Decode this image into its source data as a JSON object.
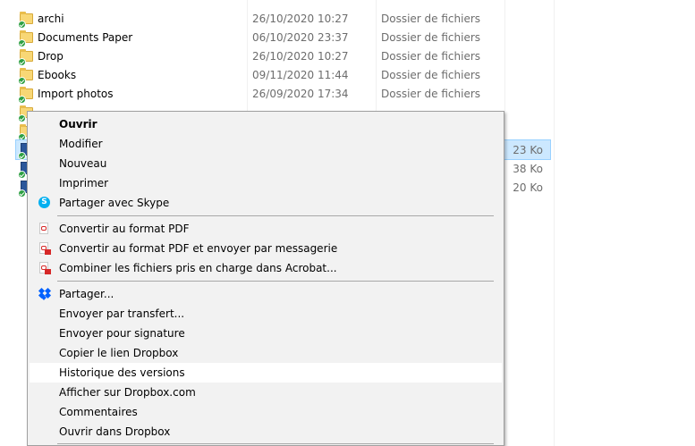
{
  "file_list": {
    "rows": [
      {
        "name": "archi",
        "date": "26/10/2020 10:27",
        "type": "Dossier de fichiers",
        "size": ""
      },
      {
        "name": "Documents Paper",
        "date": "06/10/2020 23:37",
        "type": "Dossier de fichiers",
        "size": ""
      },
      {
        "name": "Drop",
        "date": "26/10/2020 10:27",
        "type": "Dossier de fichiers",
        "size": ""
      },
      {
        "name": "Ebooks",
        "date": "09/11/2020 11:44",
        "type": "Dossier de fichiers",
        "size": ""
      },
      {
        "name": "Import photos",
        "date": "26/09/2020 17:34",
        "type": "Dossier de fichiers",
        "size": ""
      },
      {
        "name": "",
        "date": "",
        "type": "",
        "size": "23 Ko"
      },
      {
        "name": "",
        "date": "",
        "type": "",
        "size": "38 Ko"
      },
      {
        "name": "",
        "date": "",
        "type": "",
        "size": "20 Ko"
      }
    ]
  },
  "context_menu": {
    "items": [
      {
        "label": "Ouvrir",
        "icon": ""
      },
      {
        "label": "Modifier",
        "icon": ""
      },
      {
        "label": "Nouveau",
        "icon": ""
      },
      {
        "label": "Imprimer",
        "icon": ""
      },
      {
        "label": "Partager avec Skype",
        "icon": "skype-icon"
      },
      {
        "label": "Convertir au format PDF",
        "icon": "pdf-icon"
      },
      {
        "label": "Convertir au format PDF et envoyer par messagerie",
        "icon": "pdf-mail-icon"
      },
      {
        "label": "Combiner les fichiers pris en charge dans Acrobat...",
        "icon": "pdf-combine-icon"
      },
      {
        "label": "Partager...",
        "icon": "dropbox-icon"
      },
      {
        "label": "Envoyer par transfert...",
        "icon": ""
      },
      {
        "label": "Envoyer pour signature",
        "icon": ""
      },
      {
        "label": "Copier le lien Dropbox",
        "icon": ""
      },
      {
        "label": "Historique des versions",
        "icon": ""
      },
      {
        "label": "Afficher sur Dropbox.com",
        "icon": ""
      },
      {
        "label": "Commentaires",
        "icon": ""
      },
      {
        "label": "Ouvrir dans Dropbox",
        "icon": ""
      }
    ],
    "hovered_item": "Historique des versions"
  },
  "colors": {
    "selection": "#cce8ff",
    "menu_background": "#f2f2f2",
    "dropbox_blue": "#0061fe",
    "skype_blue": "#00aff0",
    "pdf_red": "#d62828",
    "sync_green": "#2ea043"
  }
}
